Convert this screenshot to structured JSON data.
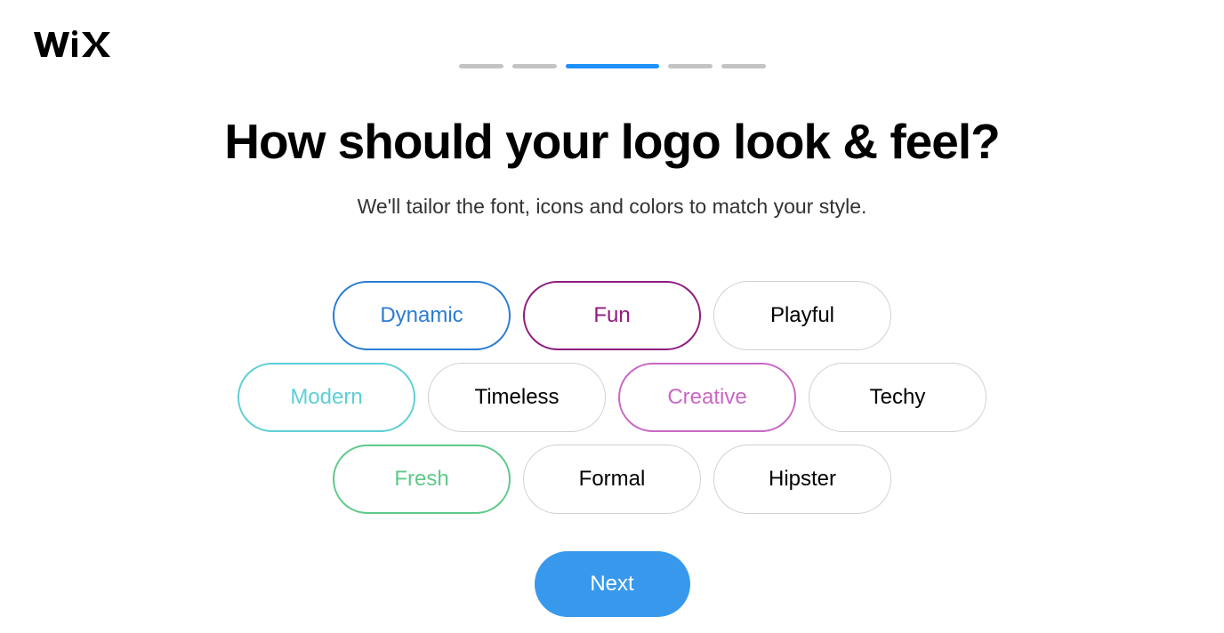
{
  "brand": "WiX",
  "progress": {
    "segments": [
      {
        "type": "short",
        "active": false
      },
      {
        "type": "short",
        "active": false
      },
      {
        "type": "long",
        "active": true
      },
      {
        "type": "short",
        "active": false
      },
      {
        "type": "short",
        "active": false
      }
    ]
  },
  "title": "How should your logo look & feel?",
  "subtitle": "We'll tailor the font, icons and colors to match your style.",
  "options": {
    "row1": [
      {
        "label": "Dynamic",
        "selected": true,
        "color": "#2b7cd3"
      },
      {
        "label": "Fun",
        "selected": true,
        "color": "#8e1b7e"
      },
      {
        "label": "Playful",
        "selected": false,
        "color": null
      }
    ],
    "row2": [
      {
        "label": "Modern",
        "selected": true,
        "color": "#5dcfd5"
      },
      {
        "label": "Timeless",
        "selected": false,
        "color": null
      },
      {
        "label": "Creative",
        "selected": true,
        "color": "#c967c4"
      },
      {
        "label": "Techy",
        "selected": false,
        "color": null
      }
    ],
    "row3": [
      {
        "label": "Fresh",
        "selected": true,
        "color": "#5fc98a"
      },
      {
        "label": "Formal",
        "selected": false,
        "color": null
      },
      {
        "label": "Hipster",
        "selected": false,
        "color": null
      }
    ]
  },
  "next_button": "Next"
}
